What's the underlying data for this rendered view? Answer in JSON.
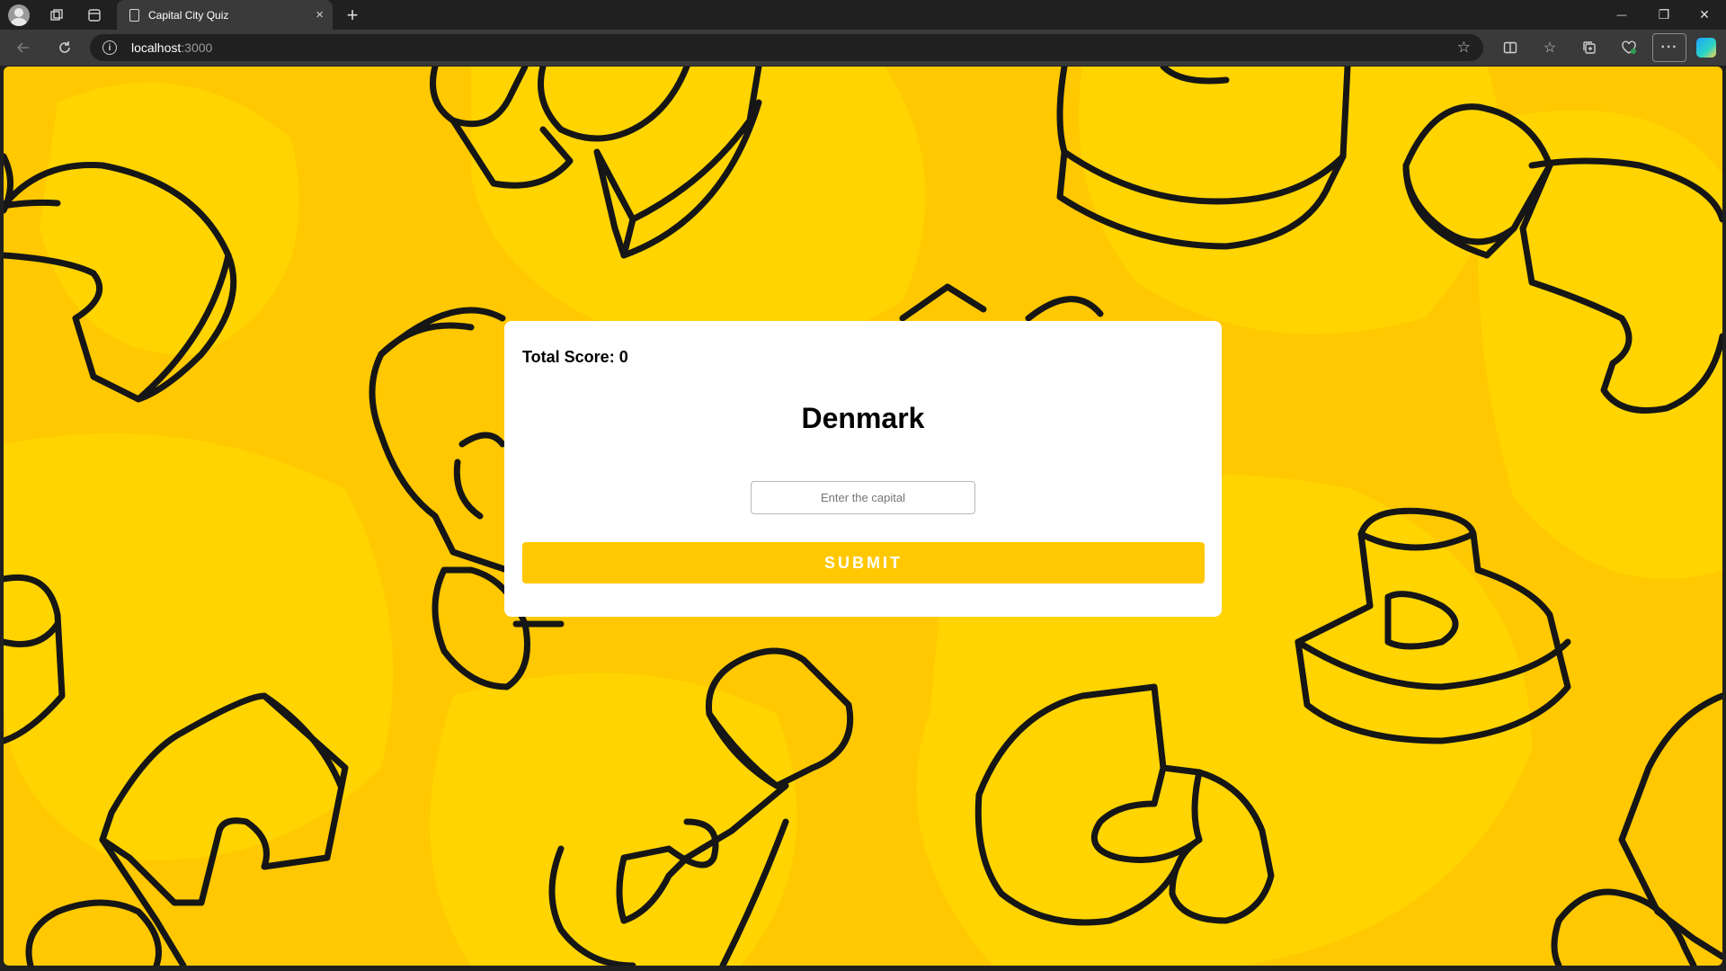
{
  "browser": {
    "tab_title": "Capital City Quiz",
    "tab_close": "×",
    "new_tab": "+",
    "url_host": "localhost",
    "url_port": ":3000",
    "window_controls": {
      "minimize": "—",
      "restore": "❐",
      "close": "✕"
    },
    "icons": [
      "profile-icon",
      "workspaces-icon",
      "tab-actions-icon",
      "back-icon",
      "refresh-icon",
      "info-icon",
      "favorite-star-icon",
      "split-screen-icon",
      "favorites-icon",
      "collections-icon",
      "browser-essentials-icon",
      "more-icon",
      "copilot-icon"
    ]
  },
  "quiz": {
    "score_label": "Total Score:",
    "score_value": "0",
    "country": "Denmark",
    "answer_placeholder": "Enter the capital",
    "answer_value": "",
    "submit_label": "SUBMIT"
  },
  "colors": {
    "background": "#ffc800",
    "background_blob": "#ffd400",
    "outline": "#1a1a1a",
    "card": "#ffffff",
    "submit_button": "#ffc800"
  }
}
